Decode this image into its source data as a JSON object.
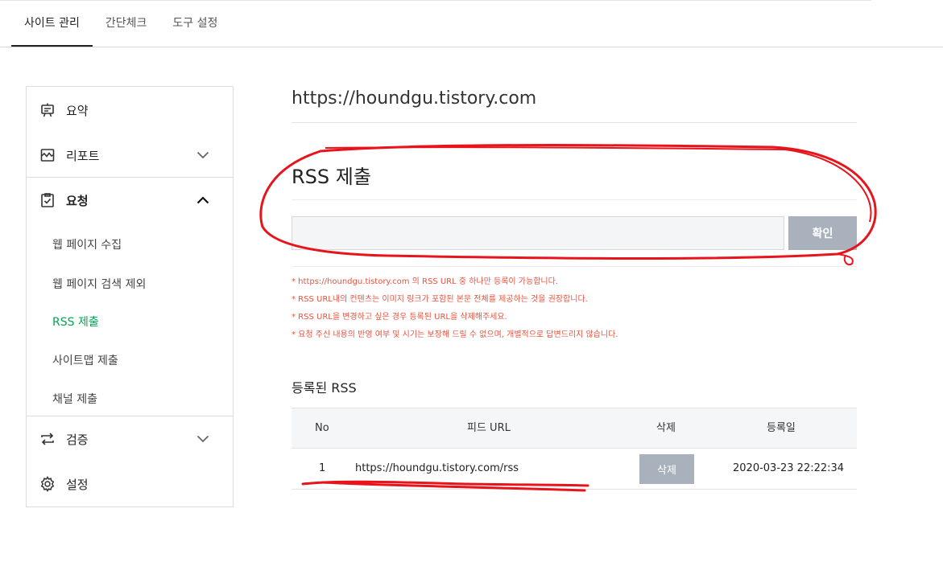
{
  "tabs": [
    {
      "label": "사이트 관리"
    },
    {
      "label": "간단체크"
    },
    {
      "label": "도구 설정"
    }
  ],
  "sidebar": {
    "summary": "요약",
    "report": "리포트",
    "request": "요청",
    "request_items": [
      "웹 페이지 수집",
      "웹 페이지 검색 제외",
      "RSS 제출",
      "사이트맵 제출",
      "채널 제출"
    ],
    "verify": "검증",
    "settings": "설정"
  },
  "site_url": "https://houndgu.tistory.com",
  "rss_section": {
    "title": "RSS 제출",
    "input_value": "",
    "confirm_label": "확인",
    "notes": [
      "* https://houndgu.tistory.com 의 RSS URL 중 하나만 등록이 가능합니다.",
      "* RSS URL내의 컨텐츠는 이미지 링크가 포함된 본문 전체를 제공하는 것을 권장합니다.",
      "* RSS URL을 변경하고 싶은 경우 등록된 URL을 삭제해주세요.",
      "* 요청 주신 내용의 반영 여부 및 시기는 보장해 드릴 수 없으며, 개별적으로 답변드리지 않습니다."
    ]
  },
  "registered": {
    "title": "등록된 RSS",
    "headers": {
      "no": "No",
      "feed": "피드 URL",
      "delete": "삭제",
      "date": "등록일"
    },
    "rows": [
      {
        "no": "1",
        "feed": "https://houndgu.tistory.com/rss",
        "delete_label": "삭제",
        "date": "2020-03-23 22:22:34"
      }
    ]
  },
  "colors": {
    "accent_green": "#00a84f",
    "note_red": "#e8533f",
    "button_gray": "#a9b2bc",
    "annotation_red": "#e8141c"
  }
}
